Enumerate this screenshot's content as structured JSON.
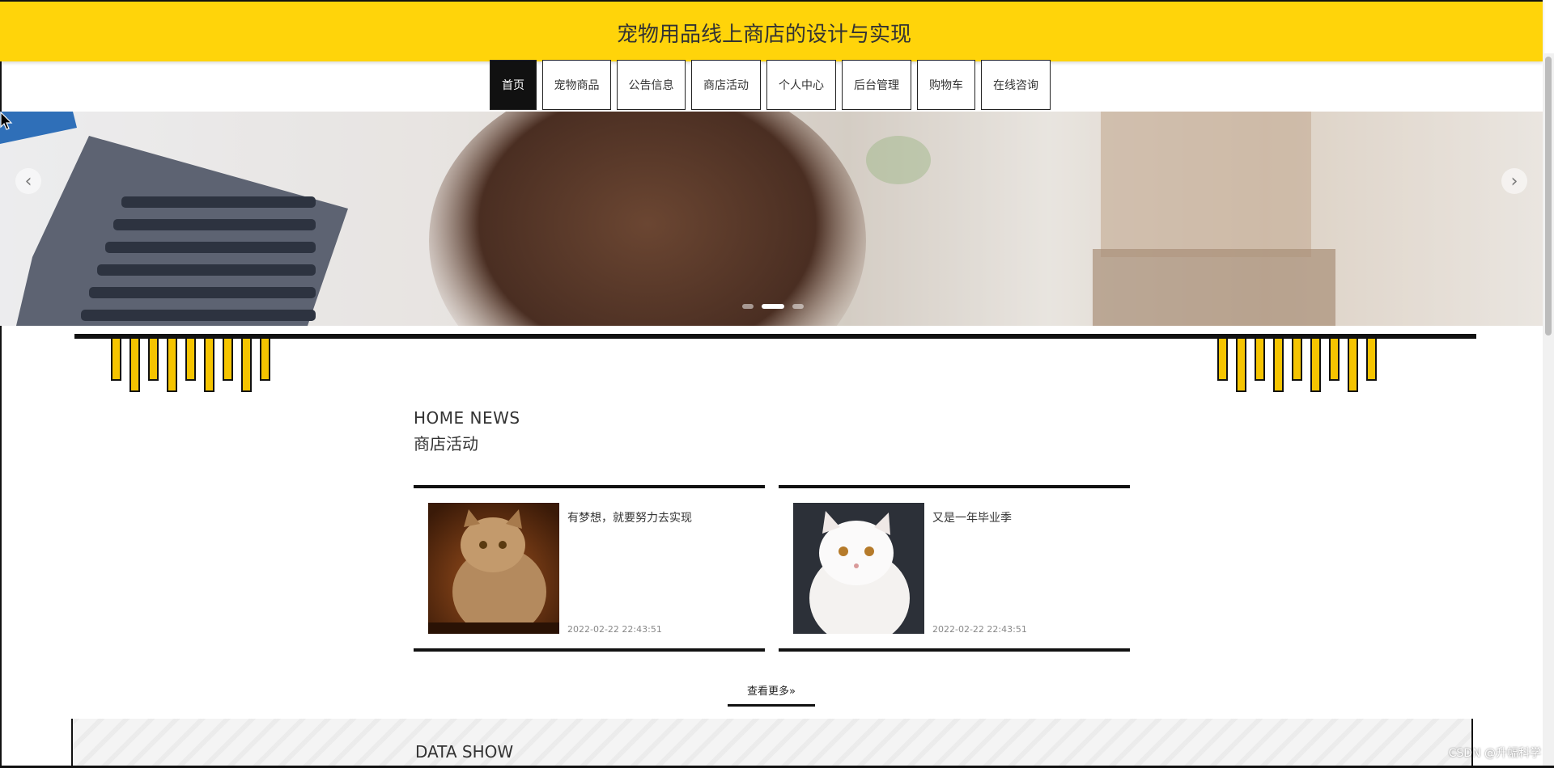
{
  "header": {
    "title": "宠物用品线上商店的设计与实现"
  },
  "nav": {
    "items": [
      "首页",
      "宠物商品",
      "公告信息",
      "商店活动",
      "个人中心",
      "后台管理",
      "购物车",
      "在线咨询"
    ],
    "active_index": 0
  },
  "carousel": {
    "prev_icon": "‹",
    "next_icon": "›",
    "slide_count": 3,
    "active_slide": 1
  },
  "news": {
    "en_title": "HOME NEWS",
    "cn_title": "商店活动",
    "items": [
      {
        "title": "有梦想，就要努力去实现",
        "date": "2022-02-22 22:43:51"
      },
      {
        "title": "又是一年毕业季",
        "date": "2022-02-22 22:43:51"
      }
    ],
    "more_label": "查看更多"
  },
  "data_show": {
    "title": "DATA SHOW"
  },
  "watermark": "CSDN @升幅科学",
  "colors": {
    "accent": "#ffd40a",
    "dark": "#111111",
    "tassel": "#f5c400"
  }
}
